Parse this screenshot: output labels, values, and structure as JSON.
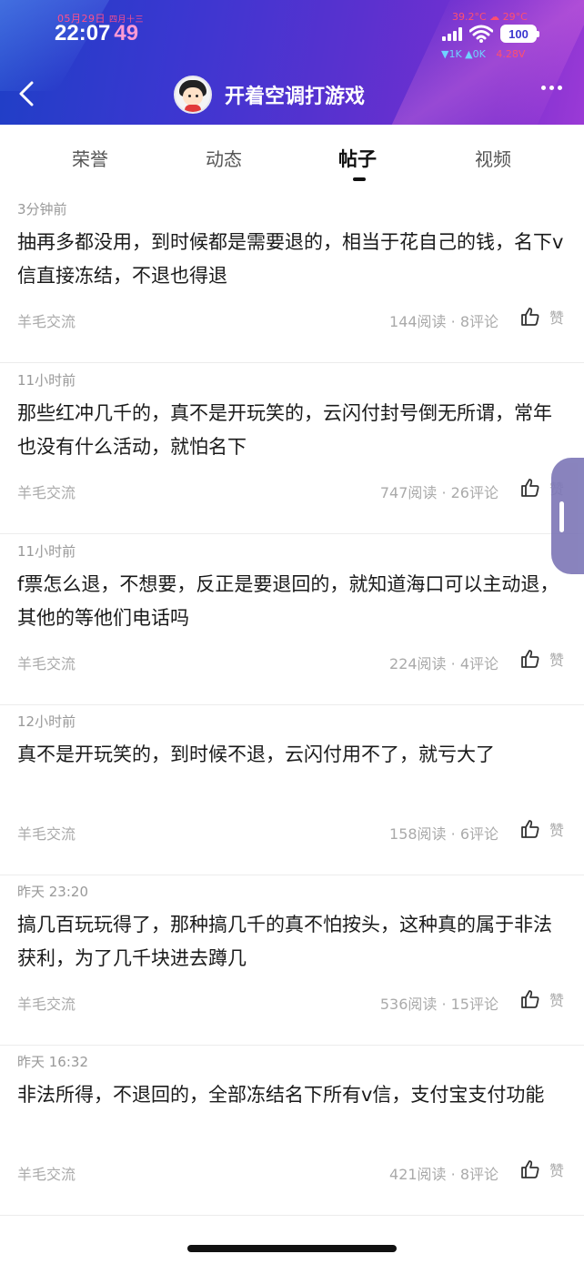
{
  "status_bar": {
    "date": "05月29日",
    "lunar": "四月十三",
    "time": "22:07",
    "seconds": "49",
    "temps": "39.2°C ☁ 29°C",
    "battery": "100",
    "net_down": "▼1K",
    "net_up": "▲0K",
    "voltage": "4.28V"
  },
  "header": {
    "title": "开着空调打游戏"
  },
  "tabs": [
    {
      "label": "荣誉"
    },
    {
      "label": "动态"
    },
    {
      "label": "帖子"
    },
    {
      "label": "视频"
    }
  ],
  "active_tab": "帖子",
  "posts": [
    {
      "time": "3分钟前",
      "content": "抽再多都没用，到时候都是需要退的，相当于花自己的钱，名下v信直接冻结，不退也得退",
      "tag": "羊毛交流",
      "stats": "144阅读 · 8评论",
      "like": "赞"
    },
    {
      "time": "11小时前",
      "content": "那些红冲几千的，真不是开玩笑的，云闪付封号倒无所谓，常年也没有什么活动，就怕名下",
      "tag": "羊毛交流",
      "stats": "747阅读 · 26评论",
      "like": "赞"
    },
    {
      "time": "11小时前",
      "content": "f票怎么退，不想要，反正是要退回的，就知道海口可以主动退，其他的等他们电话吗",
      "tag": "羊毛交流",
      "stats": "224阅读 · 4评论",
      "like": "赞"
    },
    {
      "time": "12小时前",
      "content": "真不是开玩笑的，到时候不退，云闪付用不了，就亏大了",
      "tag": "羊毛交流",
      "stats": "158阅读 · 6评论",
      "like": "赞"
    },
    {
      "time": "昨天 23:20",
      "content": "搞几百玩玩得了，那种搞几千的真不怕按头，这种真的属于非法获利，为了几千块进去蹲几",
      "tag": "羊毛交流",
      "stats": "536阅读 · 15评论",
      "like": "赞"
    },
    {
      "time": "昨天 16:32",
      "content": "非法所得，不退回的，全部冻结名下所有v信，支付宝支付功能",
      "tag": "羊毛交流",
      "stats": "421阅读 · 8评论",
      "like": "赞"
    }
  ]
}
